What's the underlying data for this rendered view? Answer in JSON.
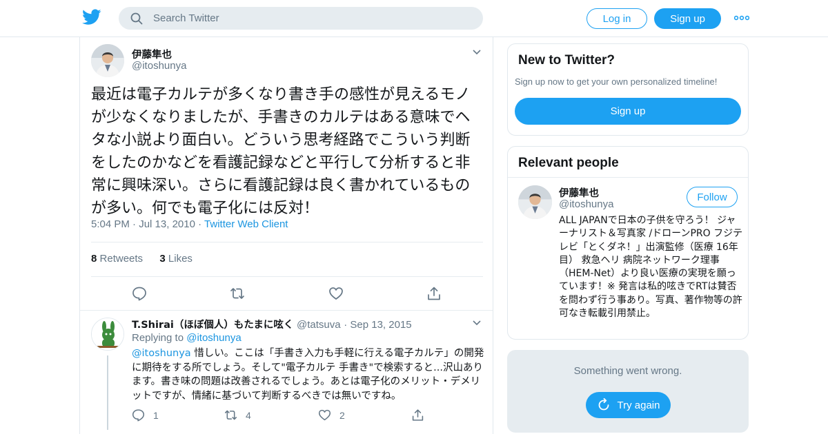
{
  "header": {
    "search_placeholder": "Search Twitter",
    "login_label": "Log in",
    "signup_label": "Sign up"
  },
  "tweet": {
    "author_name": "伊藤隼也",
    "author_handle": "@itoshunya",
    "text": "最近は電子カルテが多くなり書き手の感性が見えるモノが少なくなりましたが、手書きのカルテはある意味でヘタな小説より面白い。どういう思考経路でこういう判断をしたのかなどを看護記録などと平行して分析すると非常に興味深い。さらに看護記録は良く書かれているものが多い。何でも電子化には反対！",
    "time": "5:04 PM",
    "date": "Jul 13, 2010",
    "client": "Twitter Web Client",
    "retweet_count": "8",
    "retweet_label": "Retweets",
    "like_count": "3",
    "like_label": "Likes"
  },
  "reply": {
    "author_name": "T.Shirai（ほぼ個人）もたまに呟く",
    "author_handle": "@tatsuva",
    "date": "Sep 13, 2015",
    "replying_prefix": "Replying to",
    "replying_to": "@itoshunya",
    "mention": "@itoshunya",
    "text": " 惜しい。ここは「手書き入力も手軽に行える電子カルテ」の開発に期待をする所でしょう。そして\"電子カルテ 手書き\"で検索すると...沢山あります。書き味の問題は改善されるでしょう。あとは電子化のメリット・デメリットですが、情緒に基づいて判断するべきでは無いですね。",
    "reply_count": "1",
    "retweet_count": "4",
    "like_count": "2"
  },
  "sidebar": {
    "new_title": "New to Twitter?",
    "new_subtitle": "Sign up now to get your own personalized timeline!",
    "new_signup_label": "Sign up",
    "relevant_title": "Relevant people",
    "person_name": "伊藤隼也",
    "person_handle": "@itoshunya",
    "follow_label": "Follow",
    "person_bio": "ALL JAPANで日本の子供を守ろう！ ジャーナリスト＆写真家 /ドローンPRO フジテレビ「とくダネ！」出演監修（医療 16年目） 救急ヘリ 病院ネットワーク理事（HEM-Net）より良い医療の実現を願っています！※ 発言は私的呟きでRTは賛否を問わず行う事あり。写真、著作物等の許可なき転載引用禁止。",
    "error_message": "Something went wrong.",
    "retry_label": "Try again"
  },
  "colors": {
    "accent": "#1da1f2",
    "link": "#1b95e0",
    "muted": "#657786",
    "border": "#e1e8ed"
  }
}
